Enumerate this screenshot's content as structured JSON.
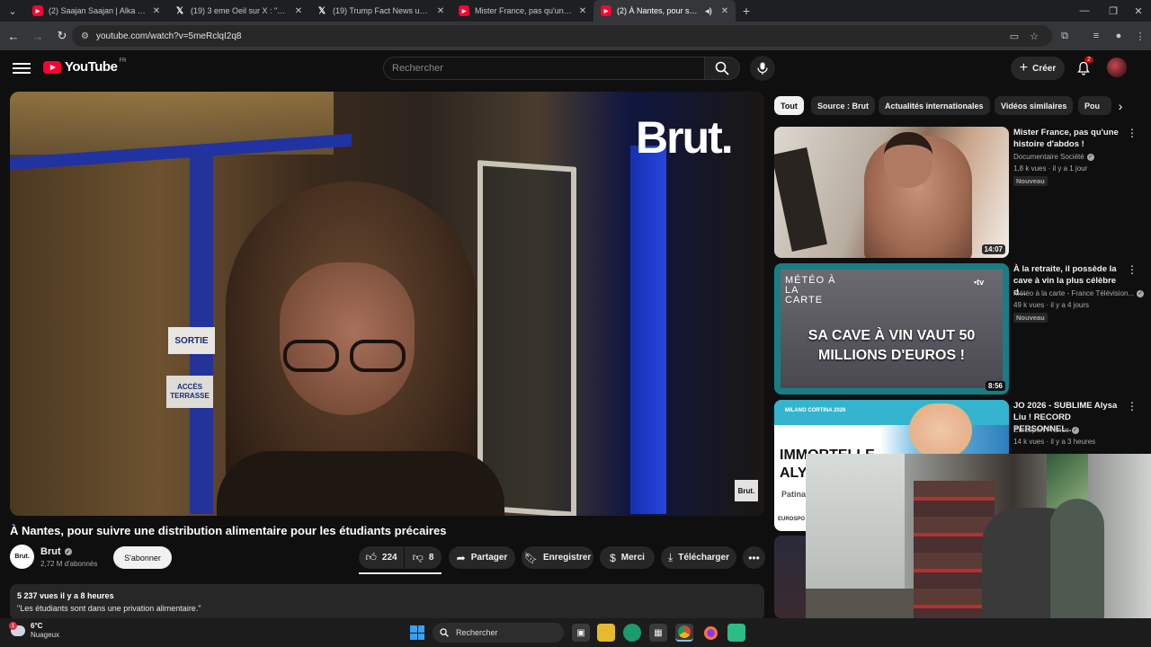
{
  "browser": {
    "tabs": [
      {
        "title": "(2) Saajan Saajan | Alka Yagnik",
        "favicon": "youtube-icon",
        "active": false
      },
      {
        "title": "(19) 3 eme Oeil sur X : \"▦ C",
        "favicon": "x-icon",
        "active": false
      },
      {
        "title": "(19) Trump Fact News us sur X",
        "favicon": "x-icon",
        "active": false
      },
      {
        "title": "Mister France, pas qu'une histo",
        "favicon": "youtube-icon",
        "active": false
      },
      {
        "title": "(2) À Nantes, pour suivre u",
        "favicon": "youtube-icon",
        "active": true
      }
    ],
    "url": "youtube.com/watch?v=5meRclqI2q8"
  },
  "youtube": {
    "logo_text": "YouTube",
    "region": "FR",
    "search_placeholder": "Rechercher",
    "create_label": "Créer",
    "notification_count": "2",
    "colors": {
      "brand": "#ff0033",
      "background": "#0f0f0f",
      "chip_bg": "#272727"
    }
  },
  "video": {
    "overlay_logo": "Brut.",
    "corner_bug": "Brut.",
    "signs": [
      "SORTIE",
      "ACCÈS TERRASSE"
    ],
    "title": "À Nantes, pour suivre une distribution alimentaire pour les étudiants précaires",
    "channel": {
      "name": "Brut",
      "avatar_text": "Brut.",
      "subscribers": "2,72 M d'abonnés",
      "subscribe_label": "S'abonner"
    },
    "actions": {
      "likes": "224",
      "dislikes": "8",
      "share": "Partager",
      "save": "Enregistrer",
      "thanks": "Merci",
      "download": "Télécharger"
    },
    "description": {
      "meta": "5 237 vues  il y a 8 heures",
      "text": "\"Les étudiants sont dans une privation alimentaire.\""
    }
  },
  "chips": [
    "Tout",
    "Source : Brut",
    "Actualités internationales",
    "Vidéos similaires",
    "Pou"
  ],
  "recommendations": [
    {
      "title": "Mister France, pas qu'une histoire d'abdos !",
      "channel": "Documentaire Société",
      "verified": true,
      "meta": "1,8 k vues · il y a 1 jour",
      "badge": "Nouveau",
      "duration": "14:07"
    },
    {
      "title": "À la retraite, il possède la cave à vin la plus célèbre d...",
      "channel": "Météo à la carte - France Télévision...",
      "verified": true,
      "meta": "49 k vues · il y a 4 jours",
      "badge": "Nouveau",
      "duration": "8:56",
      "thumb_text": {
        "top": "MÉTÉO À LA CARTE",
        "brand": "•tv",
        "headline": "SA CAVE À VIN VAUT 50 MILLIONS D'EUROS !"
      }
    },
    {
      "title": "JO 2026 - SUBLIME Alysa Liu ! RECORD PERSONNEL...",
      "channel": "Eurosport France",
      "verified": true,
      "meta": "14 k vues · il y a 3 heures",
      "thumb_text": {
        "top": "MILANO CORTINA 2026",
        "headline": "IMMORTELLE ALY",
        "sub": "Patina",
        "brand": "EUROSPO"
      }
    }
  ],
  "taskbar": {
    "weather": {
      "temp": "6°C",
      "condition": "Nuageux",
      "alert": "1"
    },
    "search_placeholder": "Rechercher"
  }
}
